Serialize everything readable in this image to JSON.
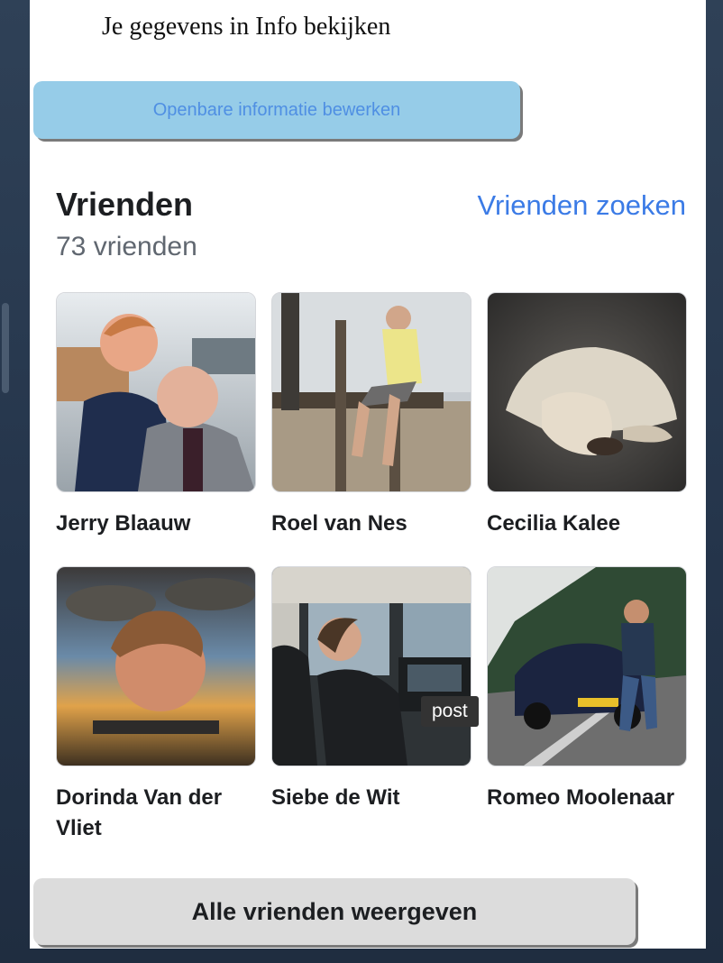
{
  "info_link": "Je gegevens in Info bekijken",
  "edit_button": "Openbare informatie bewerken",
  "friends": {
    "title": "Vrienden",
    "find_link": "Vrienden zoeken",
    "count": "73 vrienden",
    "items": [
      {
        "name": "Jerry Blaauw"
      },
      {
        "name": "Roel van Nes"
      },
      {
        "name": "Cecilia Kalee"
      },
      {
        "name": "Dorinda Van der Vliet"
      },
      {
        "name": "Siebe de Wit"
      },
      {
        "name": "Romeo Moolenaar"
      }
    ],
    "tooltip": "post",
    "all_button": "Alle vrienden weergeven"
  },
  "colors": {
    "accent": "#3b7be6",
    "edit_button_bg": "#96cce8",
    "all_button_bg": "#dcdcdc"
  }
}
